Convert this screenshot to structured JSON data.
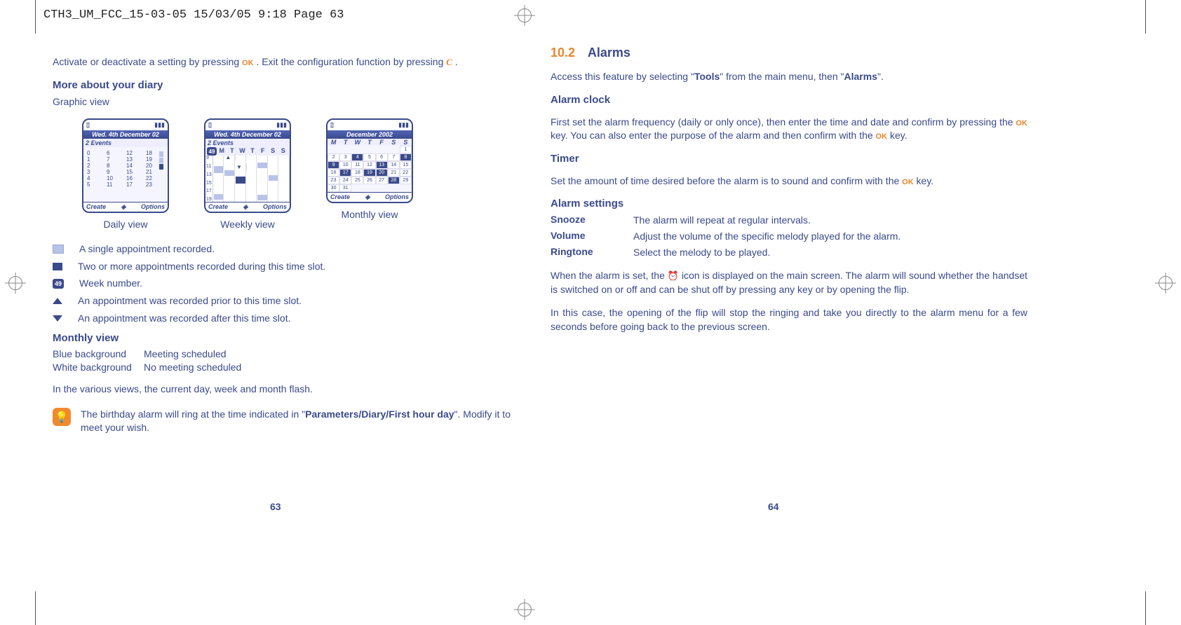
{
  "header": "CTH3_UM_FCC_15-03-05  15/03/05  9:18  Page 63",
  "left": {
    "intro": {
      "t1": "Activate or deactivate a setting by pressing ",
      "ok": "OK",
      "t2": " . Exit the configuration function by pressing ",
      "c": "C",
      "t3": " ."
    },
    "h_more": "More about your diary",
    "graphic_view": "Graphic view",
    "views": {
      "daily": {
        "title": "Wed. 4th December 02",
        "sub": "2 Events",
        "caption": "Daily view",
        "create": "Create",
        "options": "Options",
        "hours": [
          "0",
          "1",
          "2",
          "3",
          "4",
          "5",
          "6",
          "7",
          "8",
          "9",
          "10",
          "11",
          "12",
          "13",
          "14",
          "15",
          "16",
          "17",
          "18",
          "19",
          "20",
          "21",
          "22",
          "23"
        ]
      },
      "weekly": {
        "title": "Wed. 4th December 02",
        "sub": "2 Events",
        "caption": "Weekly view",
        "create": "Create",
        "options": "Options",
        "wknum": "49",
        "days": [
          "M",
          "T",
          "W",
          "T",
          "F",
          "S",
          "S"
        ],
        "hours": [
          "9",
          "11",
          "13",
          "15",
          "17",
          "19"
        ]
      },
      "monthly": {
        "title": "December 2002",
        "caption": "Monthly view",
        "create": "Create",
        "options": "Options",
        "days": [
          "M",
          "T",
          "W",
          "T",
          "F",
          "S",
          "S"
        ]
      }
    },
    "legend": {
      "l1": "A single appointment recorded.",
      "l2": "Two or more appointments recorded during this time slot.",
      "l3": "Week number.",
      "l3num": "49",
      "l4": "An appointment was recorded prior to this time slot.",
      "l5": "An appointment was recorded after this time slot."
    },
    "h_monthly": "Monthly view",
    "monthly_kv": {
      "k1": "Blue background",
      "v1": "Meeting scheduled",
      "k2": "White background",
      "v2": "No meeting scheduled"
    },
    "flash_note": "In the various views, the current day, week and month flash.",
    "tip": {
      "t1": "The birthday alarm will ring at the time indicated in \"",
      "bold": "Parameters/Diary/First hour day",
      "t2": "\". Modify it to meet your wish."
    },
    "pagenum": "63"
  },
  "right": {
    "chapter_num": "10.2",
    "chapter_title": "Alarms",
    "access": {
      "t1": "Access this feature by selecting \"",
      "b1": "Tools",
      "t2": "\" from the main menu, then \"",
      "b2": "Alarms",
      "t3": "\"."
    },
    "h_clock": "Alarm clock",
    "clock_p": {
      "t1": "First set the alarm frequency (daily or only once), then enter the time and date and confirm by pressing the ",
      "ok1": "OK",
      "t2": " key. You can also enter the purpose of the alarm and then confirm with the ",
      "ok2": "OK",
      "t3": " key."
    },
    "h_timer": "Timer",
    "timer_p": {
      "t1": "Set the amount of time desired before the alarm is to sound and confirm with the ",
      "ok": "OK",
      "t2": " key."
    },
    "h_settings": "Alarm settings",
    "settings": {
      "snooze_k": "Snooze",
      "snooze_v": "The alarm will repeat at regular intervals.",
      "volume_k": "Volume",
      "volume_v": "Adjust the volume of the specific melody played for the alarm.",
      "ringtone_k": "Ringtone",
      "ringtone_v": "Select the melody to be played."
    },
    "p_set": {
      "t1": "When the alarm is set, the ",
      "t2": " icon is displayed on the main screen. The alarm will sound whether the handset is switched on or off and can be shut off by pressing any key or by opening the flip."
    },
    "p_flip": "In this case, the opening of the flip will stop the ringing and take you directly to the alarm menu for a few seconds before going back to the previous screen.",
    "pagenum": "64"
  }
}
